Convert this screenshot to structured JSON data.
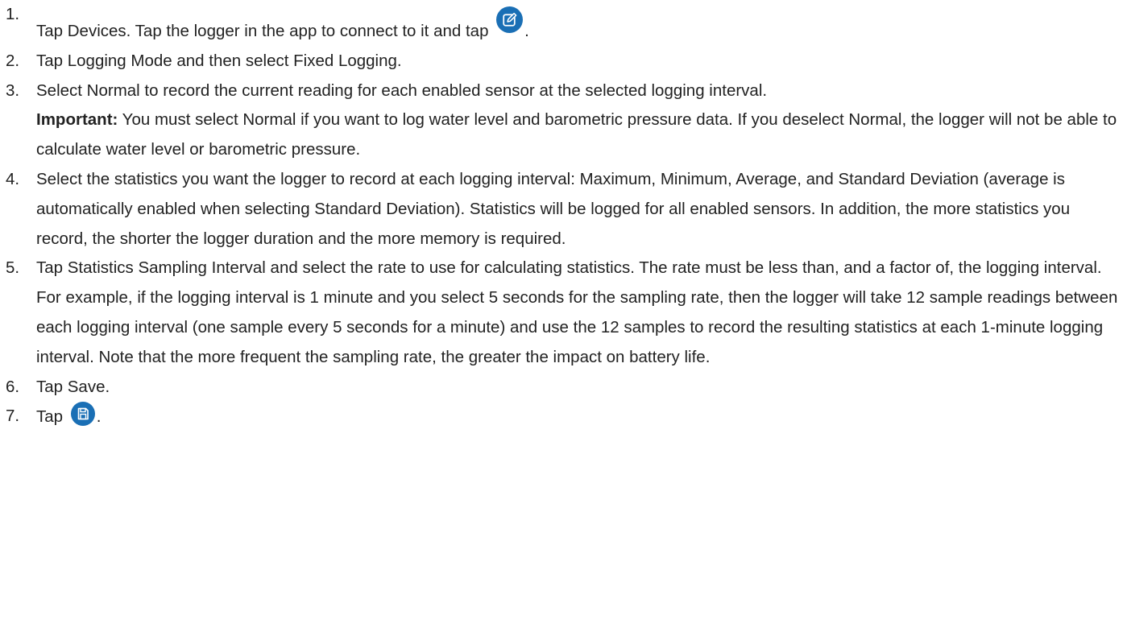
{
  "steps": [
    {
      "num": "1.",
      "before": "Tap Devices. Tap the logger in the app to connect to it and tap",
      "icon": "edit-icon",
      "after": "."
    },
    {
      "num": "2.",
      "text": "Tap Logging Mode and then select Fixed Logging."
    },
    {
      "num": "3.",
      "text": "Select Normal to record the current reading for each enabled sensor at the selected logging interval.",
      "note_label": "Important:",
      "note_text": " You must select Normal if you want to log water level and barometric pressure data. If you deselect Normal, the logger will not be able to calculate water level or barometric pressure."
    },
    {
      "num": "4.",
      "text": "Select the statistics you want the logger to record at each logging interval: Maximum, Minimum, Average, and Standard Deviation (average is automatically enabled when selecting Standard Deviation). Statistics will be logged for all enabled sensors. In addition, the more statistics you record, the shorter the logger duration and the more memory is required."
    },
    {
      "num": "5.",
      "text": "Tap Statistics Sampling Interval and select the rate to use for calculating statistics. The rate must be less than, and a factor of, the logging interval. For example, if the logging interval is 1 minute and you select 5 seconds for the sampling rate, then the logger will take 12 sample readings between each logging interval (one sample every 5 seconds for a minute) and use the 12 samples to record the resulting statistics at each 1-minute logging interval. Note that the more frequent the sampling rate, the greater the impact on battery life."
    },
    {
      "num": "6.",
      "text": "Tap Save."
    },
    {
      "num": "7.",
      "before": "Tap",
      "icon": "save-icon",
      "after": "."
    }
  ],
  "colors": {
    "text": "#222222",
    "icon_blue": "#1a6fb5"
  }
}
